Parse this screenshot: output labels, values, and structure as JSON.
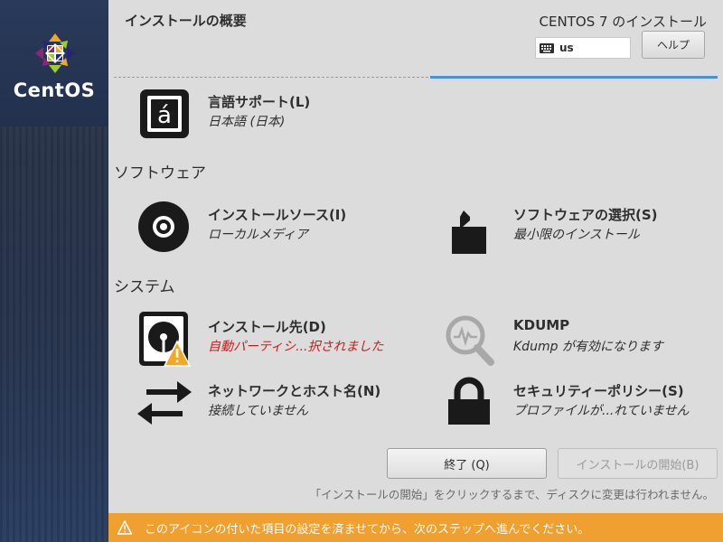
{
  "sidebar": {
    "logo_text": "CentOS"
  },
  "header": {
    "page_title": "インストールの概要",
    "product_title": "CENTOS 7 のインストール",
    "keyboard_layout": "us",
    "help_label": "ヘルプ"
  },
  "localization": {
    "items": [
      {
        "title": "言語サポート(L)",
        "status": "日本語 (日本)",
        "icon": "language-icon"
      }
    ]
  },
  "software": {
    "heading": "ソフトウェア",
    "items": [
      {
        "title": "インストールソース(I)",
        "status": "ローカルメディア",
        "icon": "disc-icon"
      },
      {
        "title": "ソフトウェアの選択(S)",
        "status": "最小限のインストール",
        "icon": "package-icon"
      }
    ]
  },
  "system": {
    "heading": "システム",
    "items": [
      {
        "title": "インストール先(D)",
        "status": "自動パーティシ...択されました",
        "icon": "harddisk-warning-icon",
        "warning": true
      },
      {
        "title": "KDUMP",
        "status": "Kdump が有効になります",
        "icon": "kdump-search-icon"
      },
      {
        "title": "ネットワークとホスト名(N)",
        "status": "接続していません",
        "icon": "network-arrows-icon"
      },
      {
        "title": "セキュリティーポリシー(S)",
        "status": "プロファイルが...れていません",
        "icon": "lock-icon"
      }
    ]
  },
  "footer": {
    "quit_label": "終了 (Q)",
    "begin_label": "インストールの開始(B)",
    "hint": "「インストールの開始」をクリックするまで、ディスクに変更は行われません。",
    "warning_text": "このアイコンの付いた項目の設定を済ませてから、次のステップへ進んでください。"
  },
  "colors": {
    "accent": "#4a90d9",
    "warning_bar": "#f0a030",
    "warning_text": "#c81d1d",
    "sidebar": "#23324f"
  }
}
